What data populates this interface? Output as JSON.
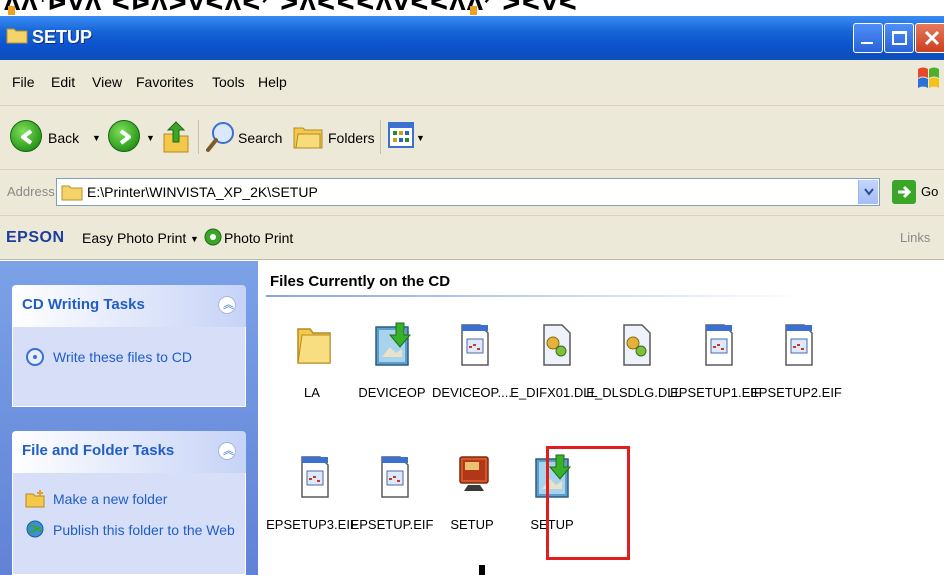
{
  "window": {
    "title": "SETUP"
  },
  "menubar": {
    "items": [
      "File",
      "Edit",
      "View",
      "Favorites",
      "Tools",
      "Help"
    ]
  },
  "toolbar": {
    "back_label": "Back",
    "search_label": "Search",
    "folders_label": "Folders"
  },
  "address": {
    "label": "Address",
    "value": "E:\\Printer\\WINVISTA_XP_2K\\SETUP",
    "go_label": "Go"
  },
  "epson_bar": {
    "logo": "EPSON",
    "easy_photo_print": "Easy Photo Print",
    "photo_print": "Photo Print",
    "links_label": "Links"
  },
  "task_pane": {
    "cd_writing": {
      "title": "CD Writing Tasks",
      "items": [
        "Write these files to CD"
      ]
    },
    "file_folder": {
      "title": "File and Folder Tasks",
      "items": [
        "Make a new folder",
        "Publish this folder to the Web"
      ]
    }
  },
  "content": {
    "section_title": "Files Currently on the CD",
    "files": [
      {
        "name": "LA",
        "icon": "folder-icon"
      },
      {
        "name": "DEVICEOP",
        "icon": "installer-icon"
      },
      {
        "name": "DEVICEOP....",
        "icon": "document-icon"
      },
      {
        "name": "E_DIFX01.DLL",
        "icon": "dll-icon"
      },
      {
        "name": "E_DLSDLG.DLL",
        "icon": "dll-icon"
      },
      {
        "name": "EPSETUP1.EIF",
        "icon": "document-icon"
      },
      {
        "name": "EPSETUP2.EIF",
        "icon": "document-icon"
      },
      {
        "name": "EPSETUP3.EIF",
        "icon": "document-icon"
      },
      {
        "name": "EPSETUP.EIF",
        "icon": "document-icon"
      },
      {
        "name": "SETUP",
        "icon": "monitor-setup-icon"
      },
      {
        "name": "SETUP",
        "icon": "installer-icon"
      }
    ]
  },
  "colors": {
    "titlebar": "#0b52cc",
    "chrome": "#ece9d8",
    "task_pane": "#6f93e0",
    "task_link": "#215dc6",
    "highlight": "#e01e1e"
  }
}
